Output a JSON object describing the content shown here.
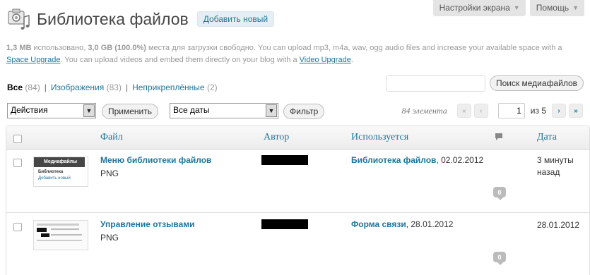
{
  "screen_meta": {
    "options_label": "Настройки экрана",
    "help_label": "Помощь"
  },
  "header": {
    "title": "Библиотека файлов",
    "add_new": "Добавить новый"
  },
  "upload_info": {
    "used": "1,3 MB",
    "used_text": " использовано, ",
    "free": "3,0 GB (100.0%)",
    "free_text": " места для загрузки свободно. You can upload mp3, m4a, wav, ogg audio files and increase your available space with a ",
    "space_link": "Space Upgrade",
    "video_text": ". You can upload videos and embed them directly on your blog with a ",
    "video_link": "Video Upgrade",
    "end": "."
  },
  "filters": [
    {
      "label": "Все",
      "count": "(84)",
      "current": true
    },
    {
      "label": "Изображения",
      "count": "(83)",
      "current": false
    },
    {
      "label": "Неприкреплённые",
      "count": "(2)",
      "current": false
    }
  ],
  "search": {
    "value": "",
    "button": "Поиск медиафайлов"
  },
  "tablenav": {
    "bulk_action": "Действия",
    "apply": "Применить",
    "dates": "Все даты",
    "filter": "Фильтр",
    "displaying": "84 элемента",
    "first": "«",
    "prev": "‹",
    "page": "1",
    "of": "из 5",
    "next": "›",
    "last": "»"
  },
  "columns": {
    "file": "Файл",
    "author": "Автор",
    "attached": "Используется",
    "date": "Дата"
  },
  "rows": [
    {
      "title": "Меню библиотеки файлов",
      "mime": "PNG",
      "attached_link": "Библиотека файлов",
      "attached_date": ", 02.02.2012",
      "comments": "0",
      "date": "3 минуты назад",
      "thumb": {
        "heading": "Медиафайлы",
        "line1": "Библиотека",
        "line2": "Добавить новый"
      }
    },
    {
      "title": "Управление отзывами",
      "mime": "PNG",
      "attached_link": "Форма связи",
      "attached_date": ", 28.01.2012",
      "comments": "0",
      "date": "28.01.2012",
      "thumb": {
        "heading": "",
        "line1": "",
        "line2": ""
      }
    }
  ],
  "colors": {
    "link": "#21759b",
    "header_bg": "#ececec"
  }
}
